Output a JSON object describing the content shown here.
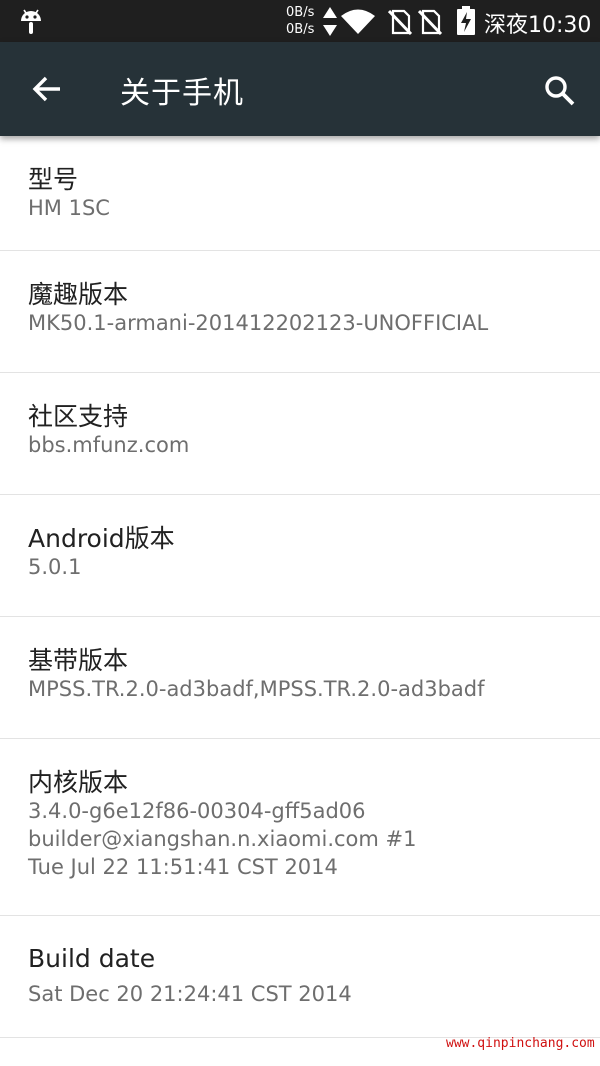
{
  "status_bar": {
    "speed_up": "0B/s",
    "speed_down": "0B/s",
    "time": "深夜10:30",
    "icons": [
      "android-icon",
      "updown-arrows-icon",
      "wifi-icon",
      "no-sim-icon",
      "no-sim-icon",
      "battery-charging-icon"
    ]
  },
  "app_bar": {
    "title": "关于手机",
    "back_icon": "arrow-left-icon",
    "search_icon": "search-icon"
  },
  "items": [
    {
      "title": "型号",
      "lines": [
        "HM 1SC"
      ]
    },
    {
      "title": "魔趣版本",
      "lines": [
        "MK50.1-armani-201412202123-UNOFFICIAL"
      ]
    },
    {
      "title": "社区支持",
      "lines": [
        "bbs.mfunz.com"
      ]
    },
    {
      "title": "Android版本",
      "lines": [
        "5.0.1"
      ]
    },
    {
      "title": "基带版本",
      "lines": [
        "MPSS.TR.2.0-ad3badf,MPSS.TR.2.0-ad3badf"
      ]
    },
    {
      "title": "内核版本",
      "lines": [
        "3.4.0-g6e12f86-00304-gff5ad06",
        "builder@xiangshan.n.xiaomi.com #1",
        "Tue Jul 22 11:51:41 CST 2014"
      ]
    },
    {
      "title": "Build date",
      "lines": [
        "Sat Dec 20 21:24:41 CST 2014"
      ]
    }
  ],
  "watermark": "www.qinpinchang.com",
  "colors": {
    "status_bar": "#1f1f1f",
    "app_bar": "#263238",
    "title_text": "#212121",
    "sub_text": "#6e6e6e",
    "watermark": "#d01010"
  }
}
